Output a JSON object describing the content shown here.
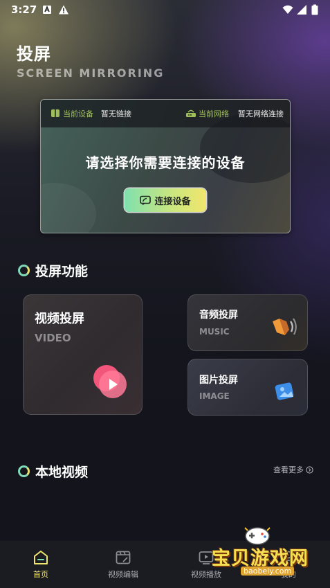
{
  "status": {
    "time": "3:27"
  },
  "header": {
    "title": "投屏",
    "subtitle": "SCREEN MIRRORING"
  },
  "connection": {
    "device_label": "当前设备",
    "device_value": "暂无链接",
    "network_label": "当前网络",
    "network_value": "暂无网络连接",
    "prompt": "请选择你需要连接的设备",
    "button_label": "连接设备"
  },
  "features": {
    "title": "投屏功能",
    "video": {
      "title": "视频投屏",
      "sub": "VIDEO"
    },
    "audio": {
      "title": "音频投屏",
      "sub": "MUSIC"
    },
    "image": {
      "title": "图片投屏",
      "sub": "IMAGE"
    }
  },
  "local": {
    "title": "本地视频",
    "more": "查看更多"
  },
  "tabs": [
    {
      "label": "首页"
    },
    {
      "label": "视频编辑"
    },
    {
      "label": "视频播放"
    },
    {
      "label": "我的"
    }
  ],
  "watermark": {
    "text": "宝贝游戏网",
    "url": "baobeiy.com"
  },
  "colors": {
    "accent": "#f1e66c",
    "accent_green": "#7fe0ae",
    "label_green": "#9fbf5b"
  }
}
